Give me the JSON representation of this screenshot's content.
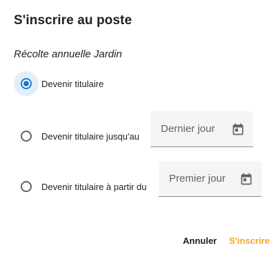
{
  "dialog": {
    "title": "S'inscrire au poste",
    "subtitle": "Récolte annuelle Jardin"
  },
  "options": [
    {
      "label": "Devenir titulaire",
      "selected": true
    },
    {
      "label": "Devenir titulaire jusqu'au",
      "selected": false,
      "field_placeholder": "Dernier jour",
      "field_icon": "calendar-icon"
    },
    {
      "label": "Devenir titulaire à partir du",
      "selected": false,
      "field_placeholder": "Premier jour",
      "field_icon": "calendar-icon"
    }
  ],
  "actions": {
    "cancel_label": "Annuler",
    "submit_label": "S'inscrire"
  },
  "colors": {
    "accent": "#1976d2",
    "submit": "#f5a623",
    "radio_focus_bg": "#e3eef9"
  }
}
